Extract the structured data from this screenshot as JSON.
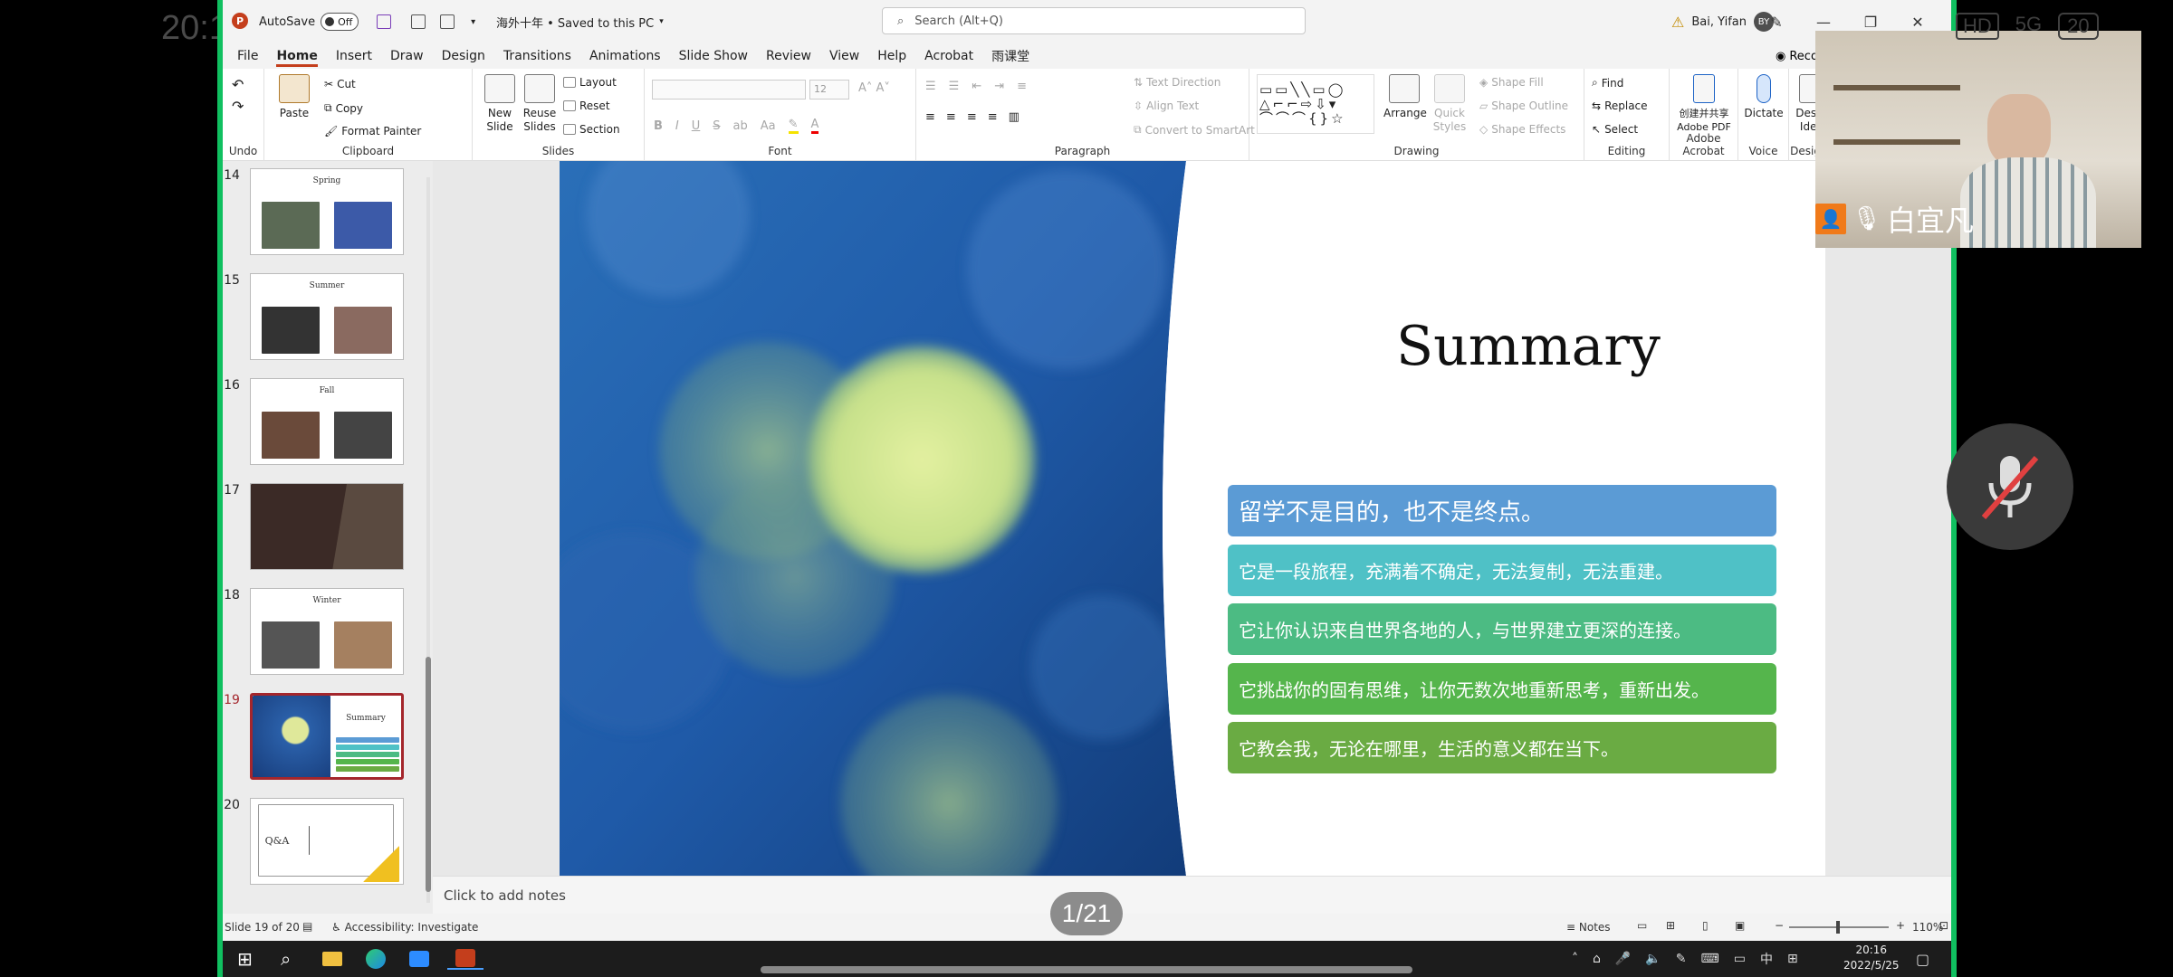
{
  "phone": {
    "time": "20:1",
    "status_icons": [
      "HD",
      "5G",
      "20"
    ]
  },
  "titlebar": {
    "app_logo": "P",
    "autosave_label": "AutoSave",
    "autosave_state": "Off",
    "doc_title": "海外十年 • Saved to this PC",
    "search_placeholder": "Search (Alt+Q)",
    "user_name": "Bai, Yifan",
    "user_initials": "BY"
  },
  "tabs": [
    "File",
    "Home",
    "Insert",
    "Draw",
    "Design",
    "Transitions",
    "Animations",
    "Slide Show",
    "Review",
    "View",
    "Help",
    "Acrobat",
    "雨课堂"
  ],
  "active_tab": "Home",
  "record_label": "Reco",
  "ribbon": {
    "groups": {
      "undo": "Undo",
      "clipboard": "Clipboard",
      "slides": "Slides",
      "font": "Font",
      "paragraph": "Paragraph",
      "drawing": "Drawing",
      "editing": "Editing",
      "adobe": "Adobe Acrobat",
      "voice": "Voice",
      "designer": "Designer"
    },
    "cut": "Cut",
    "copy": "Copy",
    "format_painter": "Format Painter",
    "paste": "Paste",
    "new_slide_1": "New",
    "new_slide_2": "Slide",
    "reuse_1": "Reuse",
    "reuse_2": "Slides",
    "layout": "Layout",
    "reset": "Reset",
    "section": "Section",
    "font_size": "12",
    "text_direction": "Text Direction",
    "align_text": "Align Text",
    "convert_smartart": "Convert to SmartArt",
    "arrange": "Arrange",
    "quick_styles_1": "Quick",
    "quick_styles_2": "Styles",
    "shape_fill": "Shape Fill",
    "shape_outline": "Shape Outline",
    "shape_effects": "Shape Effects",
    "find": "Find",
    "replace": "Replace",
    "select": "Select",
    "adobe_1": "创建并共享",
    "adobe_2": "Adobe PDF",
    "dictate": "Dictate",
    "design_1": "Design",
    "design_2": "Ideas"
  },
  "thumbnails": [
    {
      "num": "14",
      "title": "Spring"
    },
    {
      "num": "15",
      "title": "Summer"
    },
    {
      "num": "16",
      "title": "Fall"
    },
    {
      "num": "17",
      "title": ""
    },
    {
      "num": "18",
      "title": "Winter"
    },
    {
      "num": "19",
      "title": "Summary",
      "selected": true
    },
    {
      "num": "20",
      "title": "Q&A"
    }
  ],
  "slide": {
    "title": "Summary",
    "bullets": [
      {
        "text": "留学不是目的，也不是终点。",
        "color": "#5b9bd5"
      },
      {
        "text": "它是一段旅程，充满着不确定，无法复制，无法重建。",
        "color": "#4fc1c6"
      },
      {
        "text": "它让你认识来自世界各地的人，与世界建立更深的连接。",
        "color": "#4cbb83"
      },
      {
        "text": "它挑战你的固有思维，让你无数次地重新思考，重新出发。",
        "color": "#55b54c"
      },
      {
        "text": "它教会我，无论在哪里，生活的意义都在当下。",
        "color": "#6aab43"
      }
    ]
  },
  "notes_placeholder": "Click to add notes",
  "statusbar": {
    "slide_info": "Slide 19 of 20",
    "accessibility": "Accessibility: Investigate",
    "notes": "Notes",
    "zoom": "110%"
  },
  "taskbar": {
    "time": "20:16",
    "date": "2022/5/25",
    "ime": "中"
  },
  "video": {
    "participant": "白宜凡"
  },
  "page_indicator": "1/21"
}
